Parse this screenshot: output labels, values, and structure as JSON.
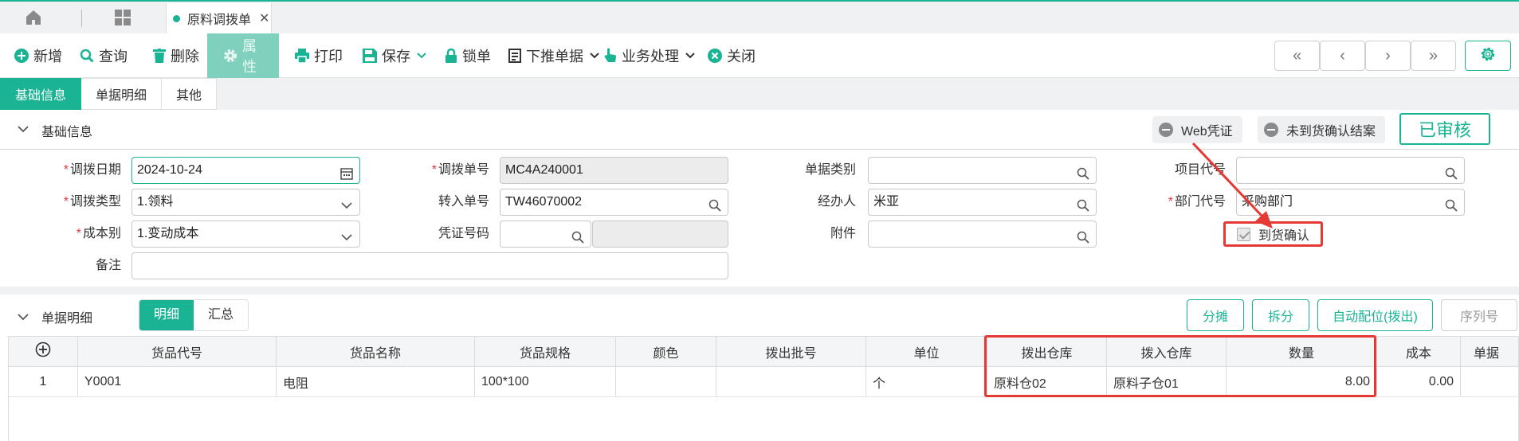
{
  "tabbar": {
    "active_tab": "原料调拨单"
  },
  "toolbar": {
    "new": "新增",
    "query": "查询",
    "delete": "删除",
    "properties": "属性",
    "print": "打印",
    "save": "保存",
    "lock": "锁单",
    "push_down": "下推单据",
    "business": "业务处理",
    "close": "关闭"
  },
  "subtabs": [
    "基础信息",
    "单据明细",
    "其他"
  ],
  "basic": {
    "title": "基础信息",
    "web_voucher": "Web凭证",
    "not_arrived": "未到货确认结案",
    "status": "已审核",
    "fields": {
      "transfer_date": {
        "label": "调拨日期",
        "value": "2024-10-24"
      },
      "transfer_no": {
        "label": "调拨单号",
        "value": "MC4A240001"
      },
      "doc_category": {
        "label": "单据类别",
        "value": ""
      },
      "project_code": {
        "label": "项目代号",
        "value": ""
      },
      "transfer_type": {
        "label": "调拨类型",
        "value": "1.领料"
      },
      "inbound_no": {
        "label": "转入单号",
        "value": "TW46070002"
      },
      "handler": {
        "label": "经办人",
        "value": "米亚"
      },
      "dept_code": {
        "label": "部门代号",
        "value": "采购部门"
      },
      "cost_type": {
        "label": "成本别",
        "value": "1.变动成本"
      },
      "voucher_no": {
        "label": "凭证号码",
        "value": ""
      },
      "attachment": {
        "label": "附件",
        "value": ""
      },
      "arrival_confirm": {
        "label": "到货确认",
        "checked": true
      },
      "remark": {
        "label": "备注",
        "value": ""
      }
    }
  },
  "detail": {
    "title": "单据明细",
    "seg": [
      "明细",
      "汇总"
    ],
    "buttons": {
      "share": "分摊",
      "split": "拆分",
      "auto": "自动配位(拨出)",
      "serial": "序列号"
    },
    "columns": [
      "货品代号",
      "货品名称",
      "货品规格",
      "颜色",
      "拨出批号",
      "单位",
      "拨出仓库",
      "拨入仓库",
      "数量",
      "成本",
      "单据"
    ],
    "rows": [
      {
        "idx": "1",
        "code": "Y0001",
        "name": "电阻",
        "spec": "100*100",
        "color": "",
        "batch": "",
        "unit": "个",
        "out_wh": "原料仓02",
        "in_wh": "原料子仓01",
        "qty": "8.00",
        "cost": "0.00",
        "doc": ""
      }
    ]
  },
  "colors": {
    "accent": "#1ab394",
    "highlight": "#e53935"
  },
  "icons": [
    "home-icon",
    "apps-icon",
    "plus-circle-icon",
    "search-icon",
    "trash-icon",
    "gear-icon",
    "printer-icon",
    "save-icon",
    "lock-icon",
    "document-icon",
    "hand-pointer-icon",
    "close-circle-icon",
    "calendar-icon",
    "chevron-down-icon"
  ]
}
